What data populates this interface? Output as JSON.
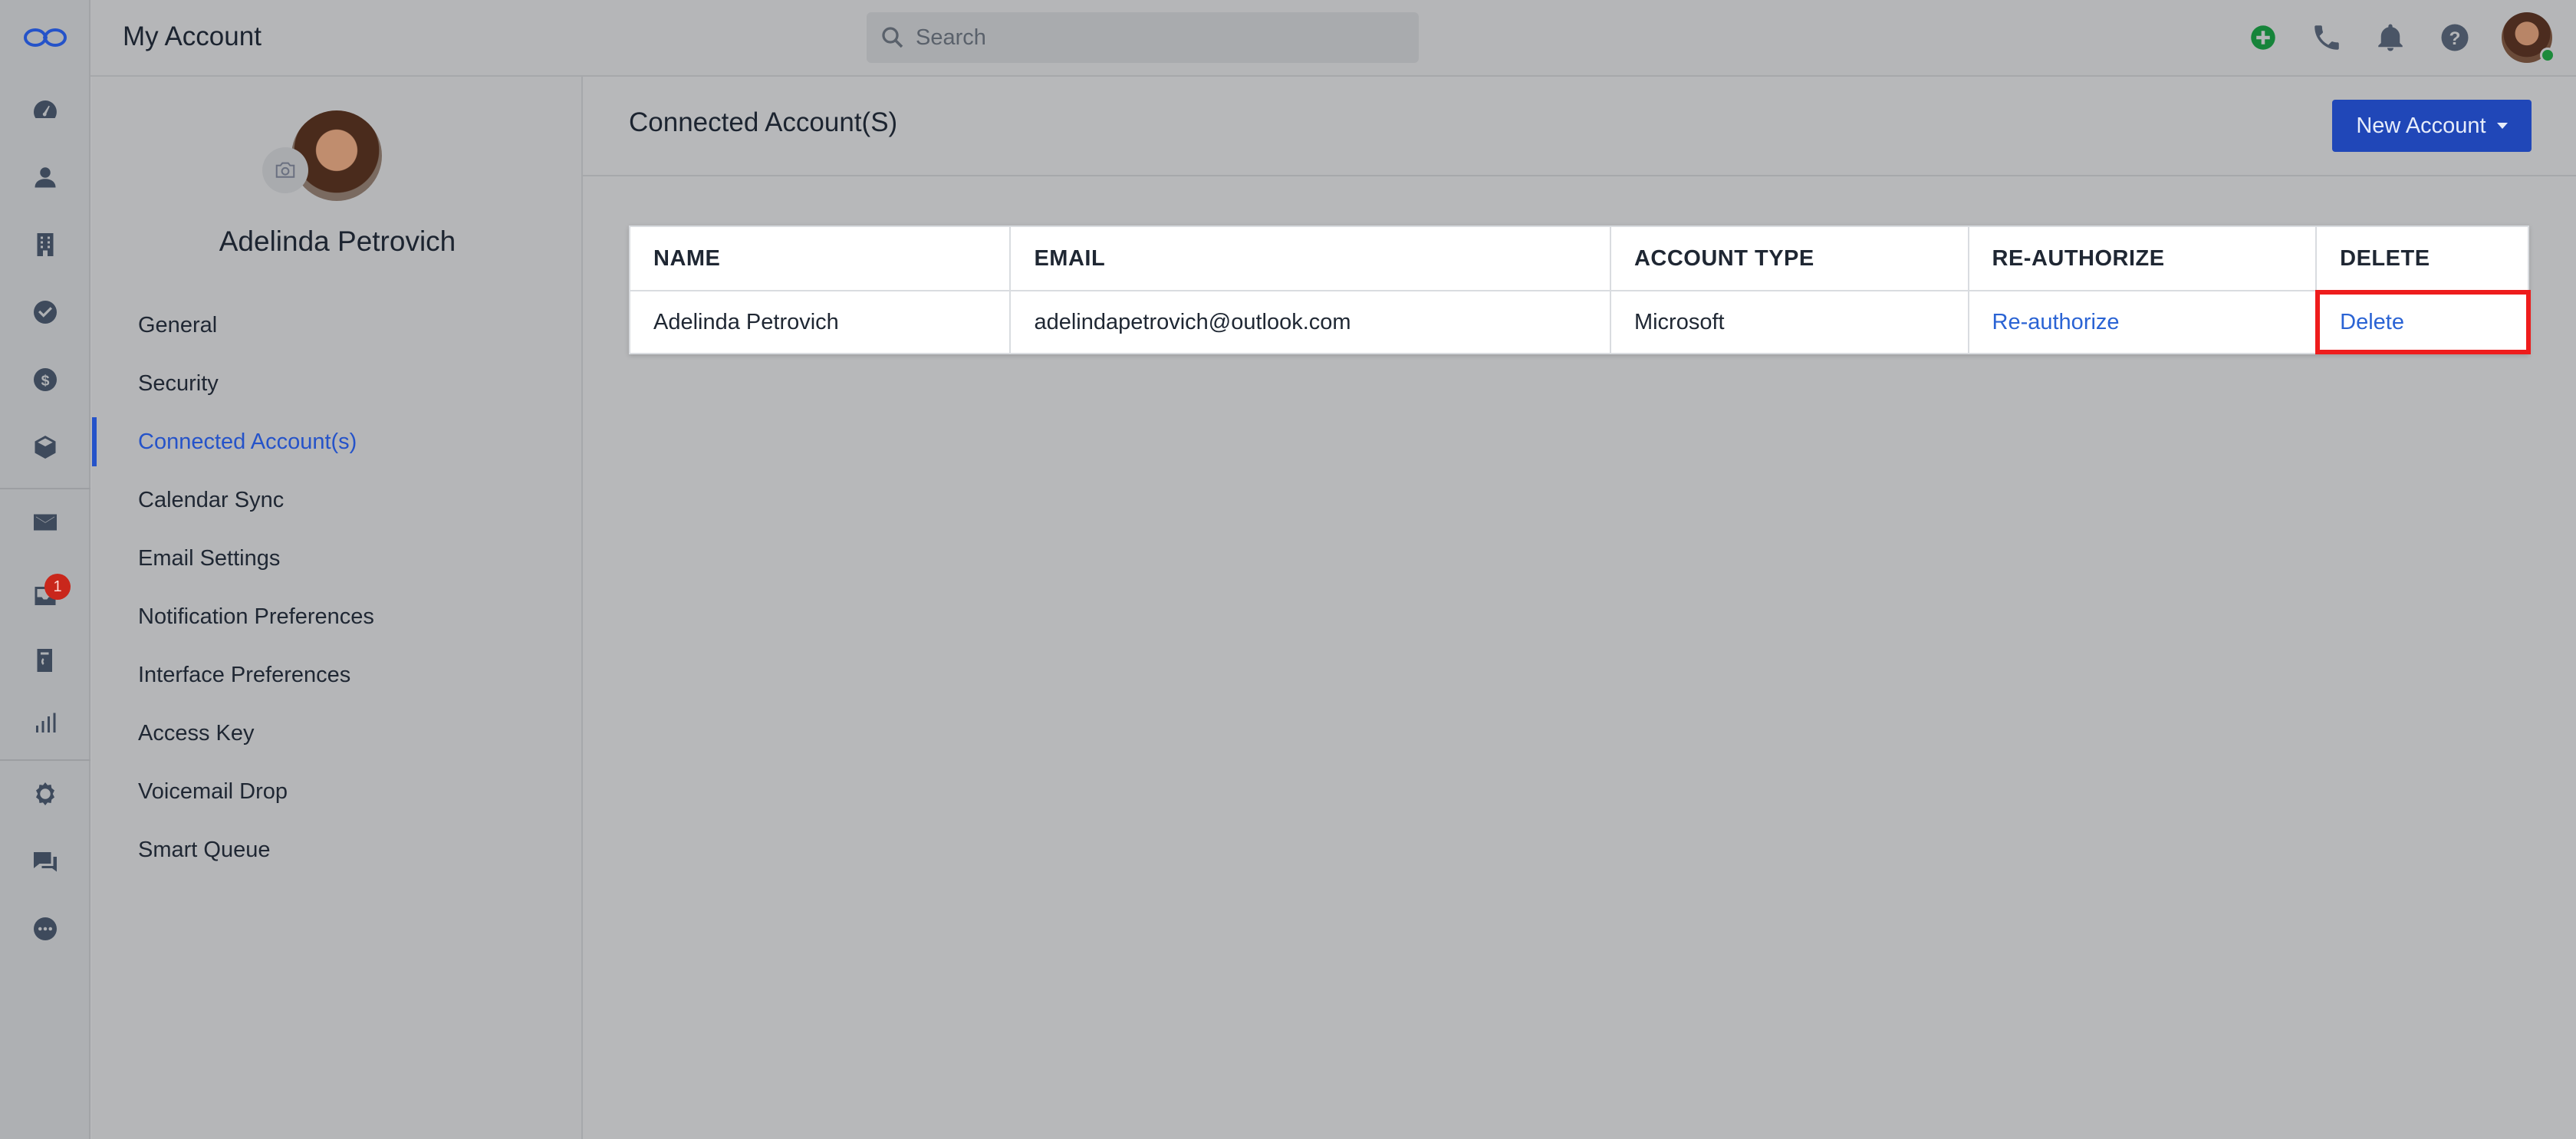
{
  "header": {
    "app_title": "My Account",
    "search_placeholder": "Search"
  },
  "rail": {
    "items": [
      "logo-icon",
      "dashboard-icon",
      "contacts-icon",
      "companies-icon",
      "tasks-icon",
      "deals-icon",
      "products-icon",
      "mail-icon",
      "inbox-icon",
      "phone-book-icon",
      "reports-icon",
      "automation-icon",
      "chat-icon",
      "more-icon"
    ],
    "inbox_badge": "1"
  },
  "profile": {
    "name": "Adelinda Petrovich"
  },
  "menu": {
    "items": [
      {
        "label": "General"
      },
      {
        "label": "Security"
      },
      {
        "label": "Connected Account(s)"
      },
      {
        "label": "Calendar Sync"
      },
      {
        "label": "Email Settings"
      },
      {
        "label": "Notification Preferences"
      },
      {
        "label": "Interface Preferences"
      },
      {
        "label": "Access Key"
      },
      {
        "label": "Voicemail Drop"
      },
      {
        "label": "Smart Queue"
      }
    ]
  },
  "content": {
    "title": "Connected Account(S)",
    "new_account_label": "New Account"
  },
  "table": {
    "headers": [
      "NAME",
      "EMAIL",
      "ACCOUNT TYPE",
      "RE-AUTHORIZE",
      "DELETE"
    ],
    "rows": [
      {
        "name": "Adelinda Petrovich",
        "email": "adelindapetrovich@outlook.com",
        "type": "Microsoft",
        "reauth": "Re-authorize",
        "delete": "Delete"
      }
    ]
  },
  "colors": {
    "accent": "#2553c9",
    "link": "#2a63d4",
    "highlight": "#ee1c1c",
    "badge": "#c9271c"
  }
}
